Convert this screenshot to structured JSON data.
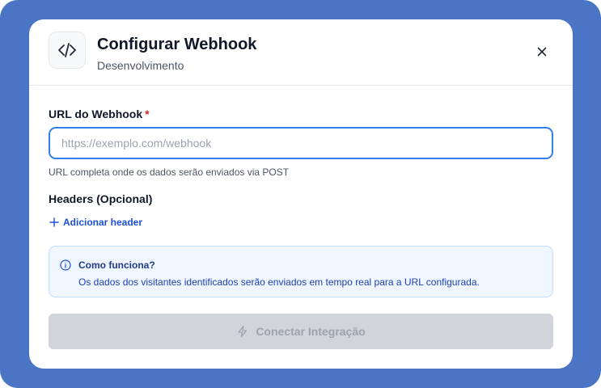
{
  "dialog": {
    "title": "Configurar Webhook",
    "subtitle": "Desenvolvimento",
    "header_icon": "code-icon",
    "close_icon": "close-icon"
  },
  "url_field": {
    "label": "URL do Webhook",
    "required_marker": "*",
    "placeholder": "https://exemplo.com/webhook",
    "value": "",
    "help": "URL completa onde os dados serão enviados via POST"
  },
  "headers": {
    "label": "Headers (Opcional)",
    "add_label": "Adicionar header",
    "add_icon": "plus-icon"
  },
  "info": {
    "icon": "info-icon",
    "title": "Como funciona?",
    "text": "Os dados dos visitantes identificados serão enviados em tempo real para a URL configurada."
  },
  "submit": {
    "label": "Conectar Integração",
    "icon": "zap-icon",
    "disabled": true
  },
  "colors": {
    "backdrop": "#4a74c4",
    "accent": "#2f80ed",
    "link": "#1d4ed8",
    "required": "#dc2626",
    "info_bg": "#eff6ff",
    "info_border": "#bfdbfe",
    "button_disabled_bg": "#d1d5db",
    "button_disabled_text": "#9ca3af"
  }
}
